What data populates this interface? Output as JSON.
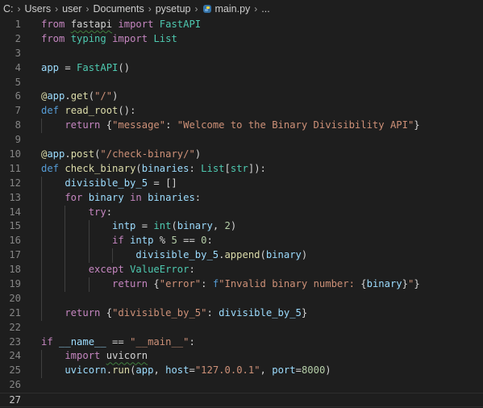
{
  "breadcrumb": {
    "items": [
      "C:",
      "Users",
      "user",
      "Documents",
      "pysetup"
    ],
    "file": "main.py",
    "ellipsis": "..."
  },
  "editor": {
    "active_line": 27,
    "lines": [
      {
        "n": 1,
        "tokens": [
          [
            "from ",
            "kw"
          ],
          [
            "fastapi",
            "sq"
          ],
          [
            " ",
            ""
          ],
          [
            "import ",
            "kw"
          ],
          [
            "FastAPI",
            "cls"
          ]
        ]
      },
      {
        "n": 2,
        "tokens": [
          [
            "from ",
            "kw"
          ],
          [
            "typing ",
            "cls"
          ],
          [
            "import ",
            "kw"
          ],
          [
            "List",
            "cls"
          ]
        ]
      },
      {
        "n": 3,
        "tokens": []
      },
      {
        "n": 4,
        "tokens": [
          [
            "app",
            "var"
          ],
          [
            " = ",
            ""
          ],
          [
            "FastAPI",
            "cls"
          ],
          [
            "()",
            ""
          ]
        ]
      },
      {
        "n": 5,
        "tokens": []
      },
      {
        "n": 6,
        "tokens": [
          [
            "@",
            "fn"
          ],
          [
            "app",
            "var"
          ],
          [
            ".",
            ""
          ],
          [
            "get",
            "fn"
          ],
          [
            "(",
            ""
          ],
          [
            "\"/\"",
            "str"
          ],
          [
            ")",
            ""
          ]
        ]
      },
      {
        "n": 7,
        "tokens": [
          [
            "def ",
            "kw2"
          ],
          [
            "read_root",
            "fn"
          ],
          [
            "():",
            ""
          ]
        ]
      },
      {
        "n": 8,
        "tokens": [
          [
            "    return ",
            "kw"
          ],
          [
            "{",
            ""
          ],
          [
            "\"message\"",
            "str"
          ],
          [
            ": ",
            ""
          ],
          [
            "\"Welcome to the Binary Divisibility API\"",
            "str"
          ],
          [
            "}",
            ""
          ]
        ]
      },
      {
        "n": 9,
        "tokens": []
      },
      {
        "n": 10,
        "tokens": [
          [
            "@",
            "fn"
          ],
          [
            "app",
            "var"
          ],
          [
            ".",
            ""
          ],
          [
            "post",
            "fn"
          ],
          [
            "(",
            ""
          ],
          [
            "\"/check-binary/\"",
            "str"
          ],
          [
            ")",
            ""
          ]
        ]
      },
      {
        "n": 11,
        "tokens": [
          [
            "def ",
            "kw2"
          ],
          [
            "check_binary",
            "fn"
          ],
          [
            "(",
            ""
          ],
          [
            "binaries",
            "var"
          ],
          [
            ": ",
            ""
          ],
          [
            "List",
            "cls"
          ],
          [
            "[",
            ""
          ],
          [
            "str",
            "cls"
          ],
          [
            "]):",
            ""
          ]
        ]
      },
      {
        "n": 12,
        "tokens": [
          [
            "    divisible_by_5",
            "var"
          ],
          [
            " = []",
            ""
          ]
        ]
      },
      {
        "n": 13,
        "tokens": [
          [
            "    for ",
            "kw"
          ],
          [
            "binary ",
            "var"
          ],
          [
            "in ",
            "kw"
          ],
          [
            "binaries",
            "var"
          ],
          [
            ":",
            ""
          ]
        ]
      },
      {
        "n": 14,
        "tokens": [
          [
            "        try",
            "kw"
          ],
          [
            ":",
            ""
          ]
        ]
      },
      {
        "n": 15,
        "tokens": [
          [
            "            intp",
            "var"
          ],
          [
            " = ",
            ""
          ],
          [
            "int",
            "cls"
          ],
          [
            "(",
            ""
          ],
          [
            "binary",
            "var"
          ],
          [
            ", ",
            ""
          ],
          [
            "2",
            "num"
          ],
          [
            ")",
            ""
          ]
        ]
      },
      {
        "n": 16,
        "tokens": [
          [
            "            if ",
            "kw"
          ],
          [
            "intp",
            "var"
          ],
          [
            " % ",
            ""
          ],
          [
            "5",
            "num"
          ],
          [
            " == ",
            ""
          ],
          [
            "0",
            "num"
          ],
          [
            ":",
            ""
          ]
        ]
      },
      {
        "n": 17,
        "tokens": [
          [
            "                divisible_by_5",
            "var"
          ],
          [
            ".",
            ""
          ],
          [
            "append",
            "fn"
          ],
          [
            "(",
            ""
          ],
          [
            "binary",
            "var"
          ],
          [
            ")",
            ""
          ]
        ]
      },
      {
        "n": 18,
        "tokens": [
          [
            "        except ",
            "kw"
          ],
          [
            "ValueError",
            "cls"
          ],
          [
            ":",
            ""
          ]
        ]
      },
      {
        "n": 19,
        "tokens": [
          [
            "            return ",
            "kw"
          ],
          [
            "{",
            ""
          ],
          [
            "\"error\"",
            "str"
          ],
          [
            ": ",
            ""
          ],
          [
            "f",
            "kw2"
          ],
          [
            "\"Invalid binary number: ",
            "str"
          ],
          [
            "{",
            ""
          ],
          [
            "binary",
            "var"
          ],
          [
            "}",
            ""
          ],
          [
            "\"",
            "str"
          ],
          [
            "}",
            ""
          ]
        ]
      },
      {
        "n": 20,
        "tokens": []
      },
      {
        "n": 21,
        "tokens": [
          [
            "    return ",
            "kw"
          ],
          [
            "{",
            ""
          ],
          [
            "\"divisible_by_5\"",
            "str"
          ],
          [
            ": ",
            ""
          ],
          [
            "divisible_by_5",
            "var"
          ],
          [
            "}",
            ""
          ]
        ]
      },
      {
        "n": 22,
        "tokens": []
      },
      {
        "n": 23,
        "tokens": [
          [
            "if ",
            "kw"
          ],
          [
            "__name__",
            "var"
          ],
          [
            " == ",
            ""
          ],
          [
            "\"__main__\"",
            "str"
          ],
          [
            ":",
            ""
          ]
        ]
      },
      {
        "n": 24,
        "tokens": [
          [
            "    import ",
            "kw"
          ],
          [
            "uvicorn",
            "sq"
          ]
        ]
      },
      {
        "n": 25,
        "tokens": [
          [
            "    uvicorn",
            "var"
          ],
          [
            ".",
            ""
          ],
          [
            "run",
            "fn"
          ],
          [
            "(",
            ""
          ],
          [
            "app",
            "var"
          ],
          [
            ", ",
            ""
          ],
          [
            "host",
            "var"
          ],
          [
            "=",
            ""
          ],
          [
            "\"127.0.0.1\"",
            "str"
          ],
          [
            ", ",
            ""
          ],
          [
            "port",
            "var"
          ],
          [
            "=",
            ""
          ],
          [
            "8000",
            "num"
          ],
          [
            ")",
            ""
          ]
        ]
      },
      {
        "n": 26,
        "tokens": []
      },
      {
        "n": 27,
        "tokens": []
      }
    ]
  },
  "colors": {
    "background": "#1e1e1e",
    "keyword": "#c586c0",
    "keyword_blue": "#569cd6",
    "function": "#dcdcaa",
    "string": "#ce9178",
    "variable": "#9cdcfe",
    "class": "#4ec9b0",
    "number": "#b5cea8"
  }
}
